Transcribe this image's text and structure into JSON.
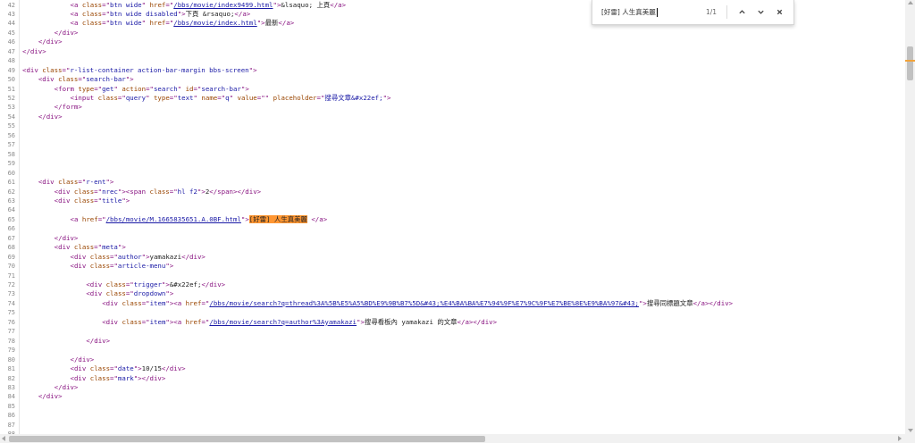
{
  "find_bar": {
    "query": "[好雷] 人生真美麗",
    "match_count": "1/1",
    "prev_icon": "chevron-up-icon",
    "next_icon": "chevron-down-icon",
    "close_icon": "close-icon"
  },
  "colors": {
    "tag": "#881280",
    "attribute": "#994500",
    "value": "#1a1aa6",
    "highlight": "#ff9632"
  },
  "source_lines": [
    {
      "n": "42",
      "indent": 12,
      "parts": [
        [
          "t",
          "<a "
        ],
        [
          "a",
          "class"
        ],
        [
          "t",
          "=\""
        ],
        [
          "v",
          "btn wide"
        ],
        [
          "t",
          "\" "
        ],
        [
          "a",
          "href"
        ],
        [
          "t",
          "=\""
        ],
        [
          "l",
          "/bbs/movie/index9499.html"
        ],
        [
          "t",
          "\">"
        ],
        [
          "x",
          "&lsaquo; 上頁"
        ],
        [
          "t",
          "</a>"
        ]
      ]
    },
    {
      "n": "43",
      "indent": 12,
      "parts": [
        [
          "t",
          "<a "
        ],
        [
          "a",
          "class"
        ],
        [
          "t",
          "=\""
        ],
        [
          "v",
          "btn wide disabled"
        ],
        [
          "t",
          "\">"
        ],
        [
          "x",
          "下頁 &rsaquo;"
        ],
        [
          "t",
          "</a>"
        ]
      ]
    },
    {
      "n": "44",
      "indent": 12,
      "parts": [
        [
          "t",
          "<a "
        ],
        [
          "a",
          "class"
        ],
        [
          "t",
          "=\""
        ],
        [
          "v",
          "btn wide"
        ],
        [
          "t",
          "\" "
        ],
        [
          "a",
          "href"
        ],
        [
          "t",
          "=\""
        ],
        [
          "l",
          "/bbs/movie/index.html"
        ],
        [
          "t",
          "\">"
        ],
        [
          "x",
          "最新"
        ],
        [
          "t",
          "</a>"
        ]
      ]
    },
    {
      "n": "45",
      "indent": 8,
      "parts": [
        [
          "t",
          "</div>"
        ]
      ]
    },
    {
      "n": "46",
      "indent": 4,
      "parts": [
        [
          "t",
          "</div>"
        ]
      ]
    },
    {
      "n": "47",
      "indent": 0,
      "parts": [
        [
          "t",
          "</div>"
        ]
      ]
    },
    {
      "n": "48",
      "indent": 0,
      "parts": []
    },
    {
      "n": "49",
      "indent": 0,
      "parts": [
        [
          "t",
          "<div "
        ],
        [
          "a",
          "class"
        ],
        [
          "t",
          "=\""
        ],
        [
          "v",
          "r-list-container action-bar-margin bbs-screen"
        ],
        [
          "t",
          "\">"
        ]
      ]
    },
    {
      "n": "50",
      "indent": 4,
      "parts": [
        [
          "t",
          "<div "
        ],
        [
          "a",
          "class"
        ],
        [
          "t",
          "=\""
        ],
        [
          "v",
          "search-bar"
        ],
        [
          "t",
          "\">"
        ]
      ]
    },
    {
      "n": "51",
      "indent": 8,
      "parts": [
        [
          "t",
          "<form "
        ],
        [
          "a",
          "type"
        ],
        [
          "t",
          "=\""
        ],
        [
          "v",
          "get"
        ],
        [
          "t",
          "\" "
        ],
        [
          "a",
          "action"
        ],
        [
          "t",
          "=\""
        ],
        [
          "v",
          "search"
        ],
        [
          "t",
          "\" "
        ],
        [
          "a",
          "id"
        ],
        [
          "t",
          "=\""
        ],
        [
          "v",
          "search-bar"
        ],
        [
          "t",
          "\">"
        ]
      ]
    },
    {
      "n": "52",
      "indent": 12,
      "parts": [
        [
          "t",
          "<input "
        ],
        [
          "a",
          "class"
        ],
        [
          "t",
          "=\""
        ],
        [
          "v",
          "query"
        ],
        [
          "t",
          "\" "
        ],
        [
          "a",
          "type"
        ],
        [
          "t",
          "=\""
        ],
        [
          "v",
          "text"
        ],
        [
          "t",
          "\" "
        ],
        [
          "a",
          "name"
        ],
        [
          "t",
          "=\""
        ],
        [
          "v",
          "q"
        ],
        [
          "t",
          "\" "
        ],
        [
          "a",
          "value"
        ],
        [
          "t",
          "=\""
        ],
        [
          "v",
          ""
        ],
        [
          "t",
          "\" "
        ],
        [
          "a",
          "placeholder"
        ],
        [
          "t",
          "=\""
        ],
        [
          "v",
          "搜尋文章&#x22ef;"
        ],
        [
          "t",
          "\">"
        ]
      ]
    },
    {
      "n": "53",
      "indent": 8,
      "parts": [
        [
          "t",
          "</form>"
        ]
      ]
    },
    {
      "n": "54",
      "indent": 4,
      "parts": [
        [
          "t",
          "</div>"
        ]
      ]
    },
    {
      "n": "55",
      "indent": 0,
      "parts": []
    },
    {
      "n": "56",
      "indent": 0,
      "parts": []
    },
    {
      "n": "57",
      "indent": 0,
      "parts": []
    },
    {
      "n": "58",
      "indent": 0,
      "parts": []
    },
    {
      "n": "59",
      "indent": 0,
      "parts": []
    },
    {
      "n": "60",
      "indent": 0,
      "parts": []
    },
    {
      "n": "61",
      "indent": 4,
      "parts": [
        [
          "t",
          "<div "
        ],
        [
          "a",
          "class"
        ],
        [
          "t",
          "=\""
        ],
        [
          "v",
          "r-ent"
        ],
        [
          "t",
          "\">"
        ]
      ]
    },
    {
      "n": "62",
      "indent": 8,
      "parts": [
        [
          "t",
          "<div "
        ],
        [
          "a",
          "class"
        ],
        [
          "t",
          "=\""
        ],
        [
          "v",
          "nrec"
        ],
        [
          "t",
          "\"><span "
        ],
        [
          "a",
          "class"
        ],
        [
          "t",
          "=\""
        ],
        [
          "v",
          "hl f2"
        ],
        [
          "t",
          "\">"
        ],
        [
          "x",
          "2"
        ],
        [
          "t",
          "</span></div>"
        ]
      ]
    },
    {
      "n": "63",
      "indent": 8,
      "parts": [
        [
          "t",
          "<div "
        ],
        [
          "a",
          "class"
        ],
        [
          "t",
          "=\""
        ],
        [
          "v",
          "title"
        ],
        [
          "t",
          "\">"
        ]
      ]
    },
    {
      "n": "64",
      "indent": 0,
      "parts": []
    },
    {
      "n": "65",
      "indent": 12,
      "parts": [
        [
          "t",
          "<a "
        ],
        [
          "a",
          "href"
        ],
        [
          "t",
          "=\""
        ],
        [
          "l",
          "/bbs/movie/M.1665835651.A.0BF.html"
        ],
        [
          "t",
          "\">"
        ],
        [
          "h",
          "[好雷] 人生真美麗"
        ],
        [
          "x",
          " "
        ],
        [
          "t",
          "</a>"
        ]
      ]
    },
    {
      "n": "66",
      "indent": 0,
      "parts": []
    },
    {
      "n": "67",
      "indent": 8,
      "parts": [
        [
          "t",
          "</div>"
        ]
      ]
    },
    {
      "n": "68",
      "indent": 8,
      "parts": [
        [
          "t",
          "<div "
        ],
        [
          "a",
          "class"
        ],
        [
          "t",
          "=\""
        ],
        [
          "v",
          "meta"
        ],
        [
          "t",
          "\">"
        ]
      ]
    },
    {
      "n": "69",
      "indent": 12,
      "parts": [
        [
          "t",
          "<div "
        ],
        [
          "a",
          "class"
        ],
        [
          "t",
          "=\""
        ],
        [
          "v",
          "author"
        ],
        [
          "t",
          "\">"
        ],
        [
          "x",
          "yamakazi"
        ],
        [
          "t",
          "</div>"
        ]
      ]
    },
    {
      "n": "70",
      "indent": 12,
      "parts": [
        [
          "t",
          "<div "
        ],
        [
          "a",
          "class"
        ],
        [
          "t",
          "=\""
        ],
        [
          "v",
          "article-menu"
        ],
        [
          "t",
          "\">"
        ]
      ]
    },
    {
      "n": "71",
      "indent": 0,
      "parts": []
    },
    {
      "n": "72",
      "indent": 16,
      "parts": [
        [
          "t",
          "<div "
        ],
        [
          "a",
          "class"
        ],
        [
          "t",
          "=\""
        ],
        [
          "v",
          "trigger"
        ],
        [
          "t",
          "\">"
        ],
        [
          "x",
          "&#x22ef;"
        ],
        [
          "t",
          "</div>"
        ]
      ]
    },
    {
      "n": "73",
      "indent": 16,
      "parts": [
        [
          "t",
          "<div "
        ],
        [
          "a",
          "class"
        ],
        [
          "t",
          "=\""
        ],
        [
          "v",
          "dropdown"
        ],
        [
          "t",
          "\">"
        ]
      ]
    },
    {
      "n": "74",
      "indent": 20,
      "parts": [
        [
          "t",
          "<div "
        ],
        [
          "a",
          "class"
        ],
        [
          "t",
          "=\""
        ],
        [
          "v",
          "item"
        ],
        [
          "t",
          "\"><a "
        ],
        [
          "a",
          "href"
        ],
        [
          "t",
          "=\""
        ],
        [
          "l",
          "/bbs/movie/search?q=thread%3A%5B%E5%A5%BD%E9%9B%B7%5D&#43;%E4%BA%BA%E7%94%9F%E7%9C%9F%E7%BE%8E%E9%BA%97&#43;"
        ],
        [
          "t",
          "\">"
        ],
        [
          "x",
          "搜尋同標題文章"
        ],
        [
          "t",
          "</a></div>"
        ]
      ]
    },
    {
      "n": "75",
      "indent": 0,
      "parts": []
    },
    {
      "n": "76",
      "indent": 20,
      "parts": [
        [
          "t",
          "<div "
        ],
        [
          "a",
          "class"
        ],
        [
          "t",
          "=\""
        ],
        [
          "v",
          "item"
        ],
        [
          "t",
          "\"><a "
        ],
        [
          "a",
          "href"
        ],
        [
          "t",
          "=\""
        ],
        [
          "l",
          "/bbs/movie/search?q=author%3Ayamakazi"
        ],
        [
          "t",
          "\">"
        ],
        [
          "x",
          "搜尋看板內 yamakazi 的文章"
        ],
        [
          "t",
          "</a></div>"
        ]
      ]
    },
    {
      "n": "77",
      "indent": 0,
      "parts": []
    },
    {
      "n": "78",
      "indent": 16,
      "parts": [
        [
          "t",
          "</div>"
        ]
      ]
    },
    {
      "n": "79",
      "indent": 0,
      "parts": []
    },
    {
      "n": "80",
      "indent": 12,
      "parts": [
        [
          "t",
          "</div>"
        ]
      ]
    },
    {
      "n": "81",
      "indent": 12,
      "parts": [
        [
          "t",
          "<div "
        ],
        [
          "a",
          "class"
        ],
        [
          "t",
          "=\""
        ],
        [
          "v",
          "date"
        ],
        [
          "t",
          "\">"
        ],
        [
          "x",
          "10/15"
        ],
        [
          "t",
          "</div>"
        ]
      ]
    },
    {
      "n": "82",
      "indent": 12,
      "parts": [
        [
          "t",
          "<div "
        ],
        [
          "a",
          "class"
        ],
        [
          "t",
          "=\""
        ],
        [
          "v",
          "mark"
        ],
        [
          "t",
          "\"></div>"
        ]
      ]
    },
    {
      "n": "83",
      "indent": 8,
      "parts": [
        [
          "t",
          "</div>"
        ]
      ]
    },
    {
      "n": "84",
      "indent": 4,
      "parts": [
        [
          "t",
          "</div>"
        ]
      ]
    },
    {
      "n": "85",
      "indent": 0,
      "parts": []
    },
    {
      "n": "86",
      "indent": 0,
      "parts": []
    },
    {
      "n": "87",
      "indent": 0,
      "parts": []
    },
    {
      "n": "88",
      "indent": 0,
      "parts": []
    }
  ]
}
